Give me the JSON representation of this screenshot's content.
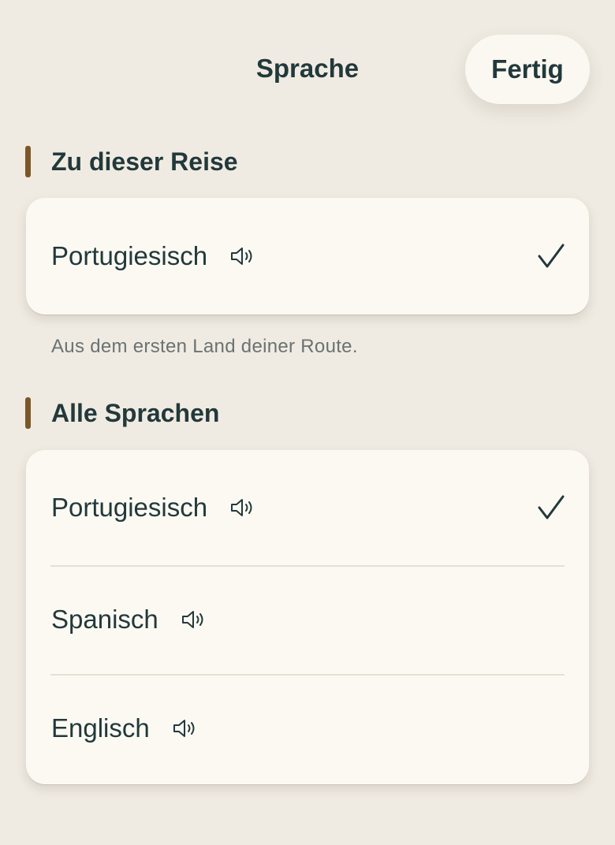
{
  "header": {
    "title": "Sprache",
    "done_label": "Fertig"
  },
  "sections": [
    {
      "heading": "Zu dieser Reise",
      "items": [
        {
          "label": "Portugiesisch",
          "selected": true
        }
      ],
      "note": "Aus dem ersten Land deiner Route."
    },
    {
      "heading": "Alle Sprachen",
      "items": [
        {
          "label": "Portugiesisch",
          "selected": true
        },
        {
          "label": "Spanisch",
          "selected": false
        },
        {
          "label": "Englisch",
          "selected": false
        }
      ]
    }
  ],
  "icons": {
    "speaker": "speaker-icon",
    "check": "checkmark-icon"
  },
  "colors": {
    "background": "#f0ebe2",
    "card": "#fcf9f3",
    "text": "#22393b",
    "accent_bar": "#7b5727",
    "note_text": "#6a7272"
  }
}
